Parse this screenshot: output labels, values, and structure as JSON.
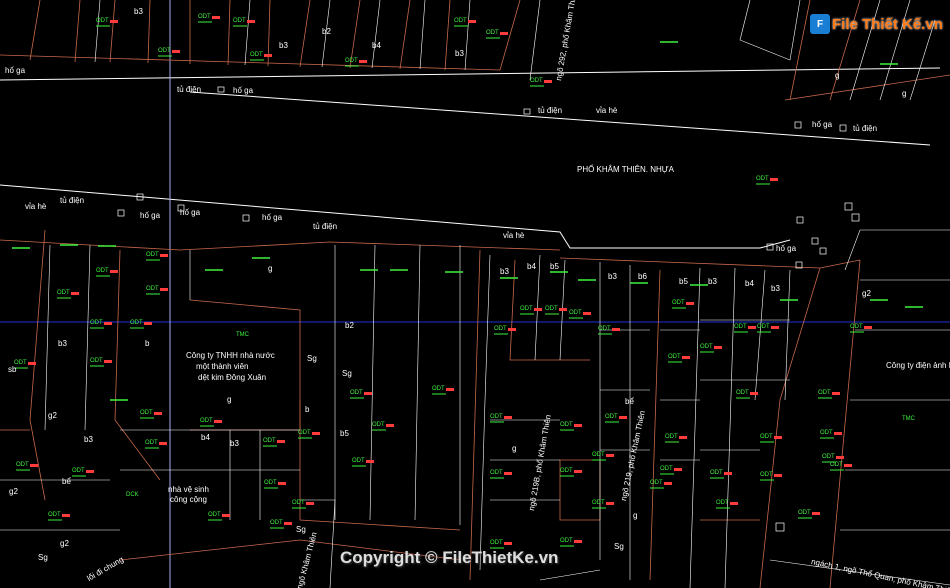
{
  "logo": {
    "mark": "F",
    "text": "File Thiết Kế.vn"
  },
  "watermark": "Copyright © FileThietKe.vn",
  "colors": {
    "boundary": "#c8684a",
    "grid": "#1f2fd6",
    "line": "#ffffff",
    "code": "#3df23d",
    "mark": "#ff3b3b"
  },
  "streets": {
    "main": "PHỐ KHÂM THIÊN. NHỰA",
    "via_he": "vỉa hè",
    "ngo_292": "ngõ 292, phố Khâm Thiên",
    "ngo_219b": "ngõ 219B, phố Khâm Thiên",
    "ngo_219": "ngõ 219, phố Khâm Thiên",
    "ngo_nhat": "ngõ Khâm Thiên",
    "ngach": "ngách 1, ngõ Thổ Quan, phố Khâm Thiên",
    "loi_di": "lối đi chung"
  },
  "utilities": {
    "ho_ga": "hố ga",
    "tu_dien": "tủ điện"
  },
  "buildings": {
    "company_1": [
      "Công ty TNHH nhà nước",
      "một thành viên",
      "dệt kim Đông Xuân"
    ],
    "company_2": "Công ty điện ảnh H",
    "toilet": [
      "nhà vệ sinh",
      "công cộng"
    ]
  },
  "labels": {
    "odt": "ODT",
    "tmc": "TMC",
    "dck": "DCK",
    "b2": "b2",
    "b3": "b3",
    "b4": "b4",
    "b5": "b5",
    "b6": "b6",
    "g": "g",
    "g2": "g2",
    "sg": "Sg",
    "be": "bể",
    "b": "b",
    "sb": "sb"
  }
}
